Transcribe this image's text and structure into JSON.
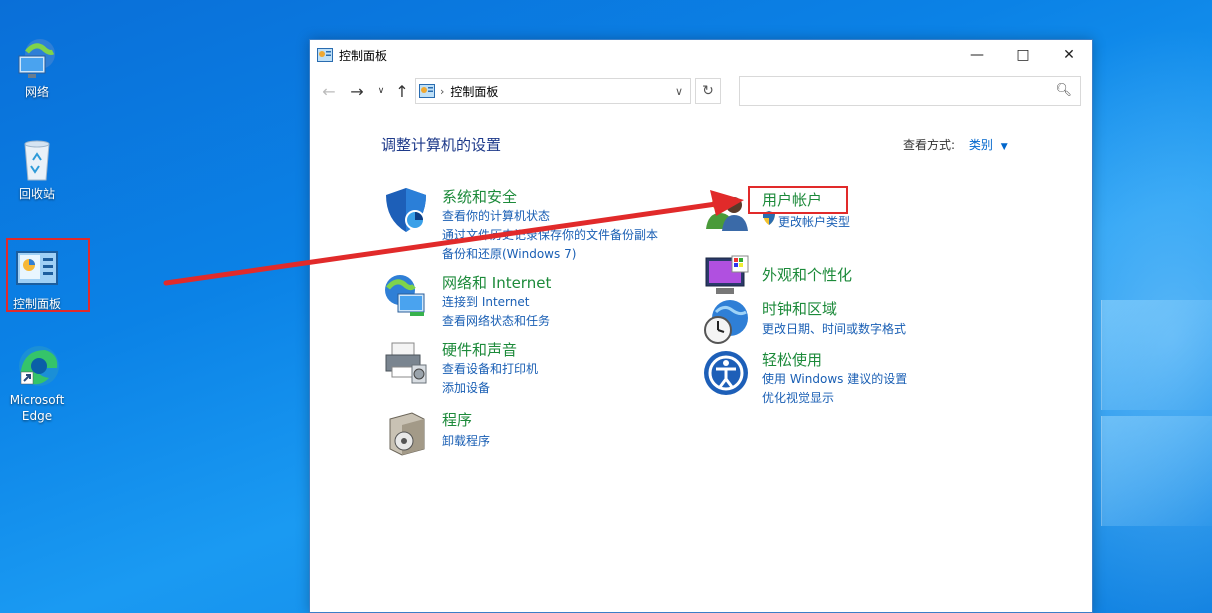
{
  "desktop": {
    "icons": [
      {
        "label": "网络"
      },
      {
        "label": "回收站"
      },
      {
        "label": "控制面板"
      },
      {
        "label": "Microsoft Edge"
      }
    ]
  },
  "window": {
    "title": "控制面板",
    "address": "控制面板",
    "search_placeholder": "",
    "heading": "调整计算机的设置",
    "view_by_label": "查看方式:",
    "view_by_value": "类别",
    "categories_left": [
      {
        "title": "系统和安全",
        "links": [
          "查看你的计算机状态",
          "通过文件历史记录保存你的文件备份副本",
          "备份和还原(Windows 7)"
        ]
      },
      {
        "title": "网络和 Internet",
        "links": [
          "连接到 Internet",
          "查看网络状态和任务"
        ]
      },
      {
        "title": "硬件和声音",
        "links": [
          "查看设备和打印机",
          "添加设备"
        ]
      },
      {
        "title": "程序",
        "links": [
          "卸载程序"
        ]
      }
    ],
    "categories_right": [
      {
        "title": "用户帐户",
        "links": [
          "更改帐户类型"
        ]
      },
      {
        "title": "外观和个性化",
        "links": []
      },
      {
        "title": "时钟和区域",
        "links": [
          "更改日期、时间或数字格式"
        ]
      },
      {
        "title": "轻松使用",
        "links": [
          "使用 Windows 建议的设置",
          "优化视觉显示"
        ]
      }
    ]
  },
  "colors": {
    "accent_red": "#e12a2a",
    "category_green": "#1c8a3a",
    "link_blue": "#1a5fb4",
    "heading_blue": "#1e3a8a"
  }
}
